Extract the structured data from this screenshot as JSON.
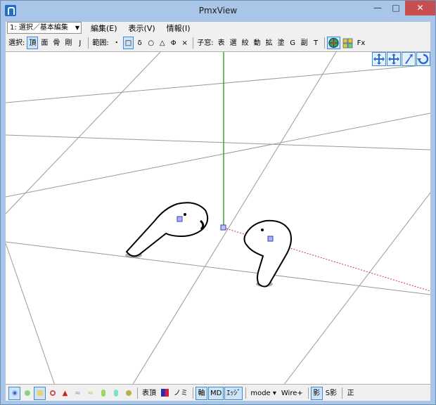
{
  "window": {
    "title": "PmxView"
  },
  "menubar": {
    "mode_select": "1: 選択／基本編集",
    "items": [
      "編集(E)",
      "表示(V)",
      "情報(I)"
    ]
  },
  "toolbar": {
    "select_label": "選択:",
    "select_items": [
      "頂",
      "面",
      "骨",
      "剛",
      "J"
    ],
    "range_label": "範囲:",
    "range_items": [
      "・",
      "□",
      "δ",
      "○",
      "△",
      "Φ",
      "×"
    ],
    "child_label": "子窓:",
    "child_items": [
      "表",
      "選",
      "絞",
      "動",
      "拡",
      "塗",
      "G",
      "副",
      "T"
    ],
    "fx_label": "Fx"
  },
  "statusbar": {
    "vert_label": "表頂",
    "nomi_label": "ノミ",
    "axis_label": "軸",
    "mb_label": "MD",
    "edge_label": "ｴｯｼﾞ",
    "mode_label": "mode ▾",
    "wire_label": "Wire+",
    "shadow_label": "影",
    "sshadow_label": "S影",
    "sei_label": "正"
  },
  "colors": {
    "accent": "#3c8ad6",
    "active_bg": "#cde4f7",
    "axis_x": "#e03030",
    "axis_y": "#2ea02e",
    "frame": "#a9c6e8"
  }
}
